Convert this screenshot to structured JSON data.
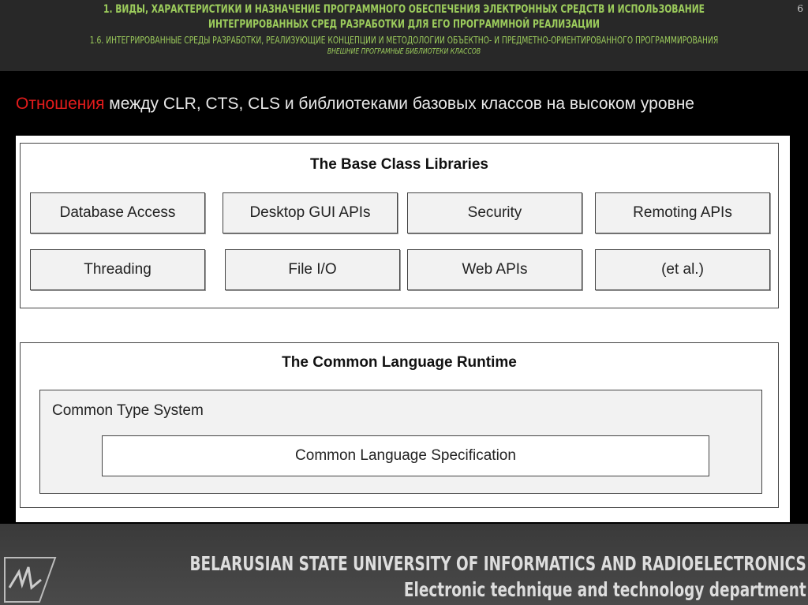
{
  "header": {
    "title": "1. ВИДЫ, ХАРАКТЕРИСТИКИ И НАЗНАЧЕНИЕ ПРОГРАММНОГО ОБЕСПЕЧЕНИЯ ЭЛЕКТРОННЫХ СРЕДСТВ И ИСПОЛЬЗОВАНИЕ ИНТЕГРИРОВАННЫХ СРЕД РАЗРАБОТКИ ДЛЯ ЕГО ПРОГРАММНОЙ РЕАЛИЗАЦИИ",
    "section": "1.6. ИНТЕГРИРОВАННЫЕ СРЕДЫ РАЗРАБОТКИ, РЕАЛИЗУЮЩИЕ КОНЦЕПЦИИ И МЕТОДОЛОГИИ ОБЪЕКТНО- И ПРЕДМЕТНО-ОРИЕНТИРОВАННОГО ПРОГРАММИРОВАНИЯ",
    "topic": "ВНЕШНИЕ ПРОГРАМНЫЕ БИБЛИОТЕКИ КЛАССОВ",
    "page_number": "6"
  },
  "subtitle": {
    "highlight": "Отношения",
    "rest": " между CLR, CTS, CLS и библиотеками базовых классов на высоком уровне"
  },
  "diagram": {
    "bcl_title": "The Base Class Libraries",
    "bcl_items": [
      "Database Access",
      "Desktop GUI APIs",
      "Security",
      "Remoting APIs",
      "Threading",
      "File I/O",
      "Web APIs",
      "(et al.)"
    ],
    "clr_title": "The Common Language Runtime",
    "cts": "Common Type System",
    "cls": "Common Language Specification"
  },
  "footer": {
    "university": "BELARUSIAN STATE UNIVERSITY OF INFORMATICS AND RADIOELECTRONICS",
    "department": "Electronic technique and technology department"
  }
}
